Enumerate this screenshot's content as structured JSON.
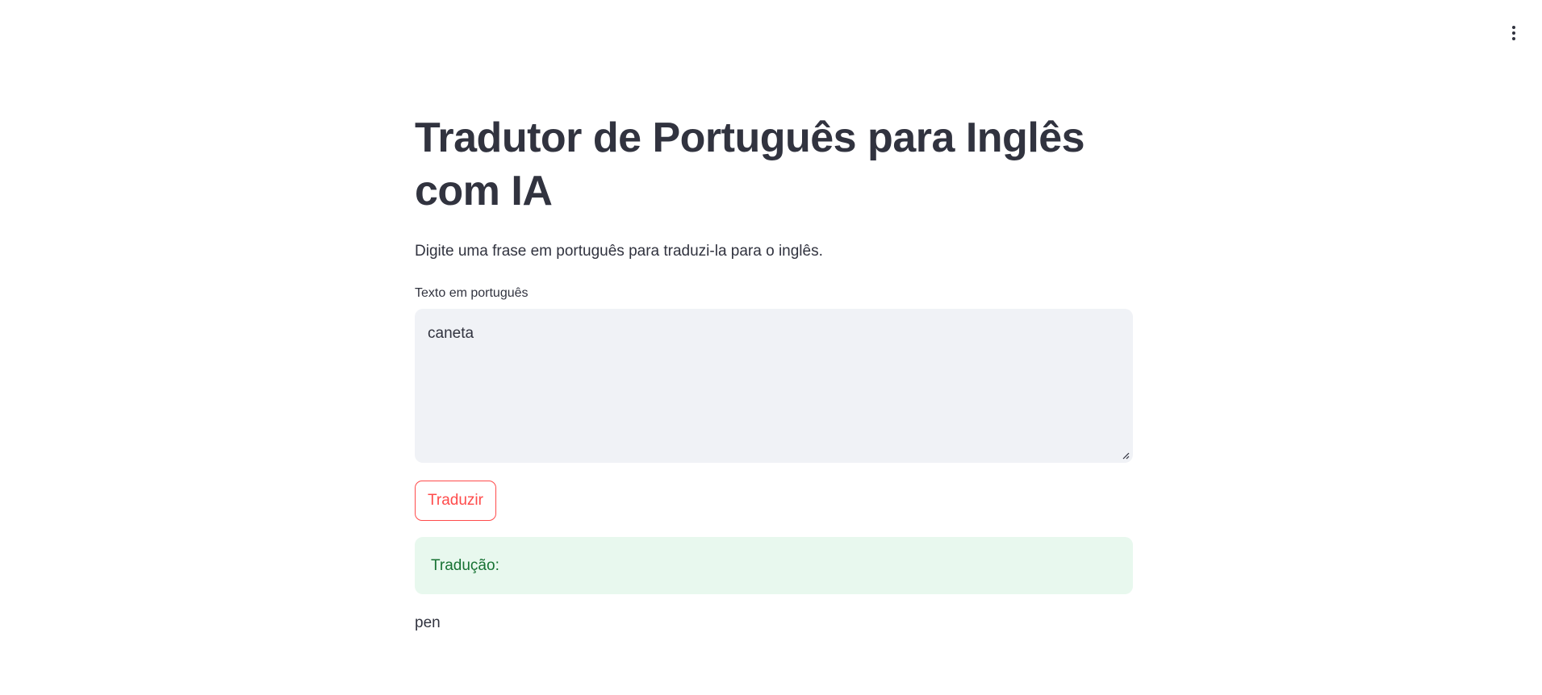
{
  "page": {
    "title": "Tradutor de Português para Inglês com IA",
    "subtitle": "Digite uma frase em português para traduzi-la para o inglês."
  },
  "input": {
    "label": "Texto em português",
    "value": "caneta"
  },
  "actions": {
    "translate_label": "Traduzir"
  },
  "result": {
    "header": "Tradução:",
    "text": "pen"
  },
  "icons": {
    "menu": "more-vertical-icon",
    "resize": "resize-handle-icon"
  },
  "colors": {
    "primary": "#ff4b4b",
    "text": "#31333f",
    "input_bg": "#f0f2f6",
    "success_bg": "#e8f8ee",
    "success_text": "#177233"
  }
}
